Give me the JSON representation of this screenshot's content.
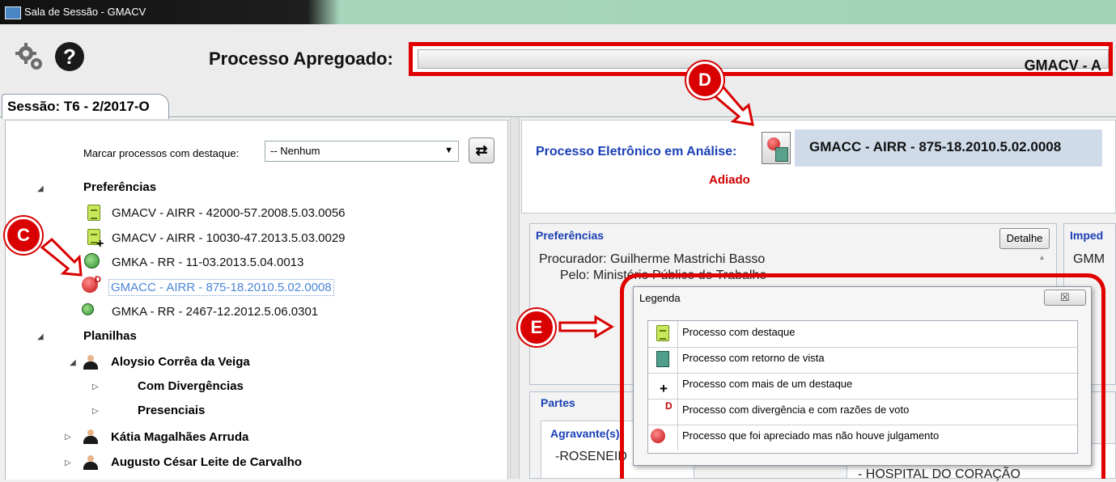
{
  "window": {
    "title": "Sala de Sessão - GMACV"
  },
  "toolbar": {
    "settings_icon": "gear-icon",
    "help_icon": "help-icon",
    "help_glyph": "?",
    "processo_label": "Processo Apregoado:",
    "processo_value": "GMACV - A"
  },
  "tab": {
    "label": "Sessão: T6 - 2/2017-O"
  },
  "left": {
    "marcar_label": "Marcar processos com destaque:",
    "marcar_value": "-- Nenhum",
    "tree": {
      "preferencias": {
        "label": "Preferências",
        "items": [
          {
            "label": "GMACV - AIRR - 42000-57.2008.5.03.0056",
            "icon": "destaque-doc-icon"
          },
          {
            "label": "GMACV - AIRR - 10030-47.2013.5.03.0029",
            "icon": "destaque-plus-doc-icon"
          },
          {
            "label": "GMKA - RR - 11-03.2013.5.04.0013",
            "icon": "retorno-vista-icon"
          },
          {
            "label": "GMACC - AIRR - 875-18.2010.5.02.0008",
            "icon": "apreciado-divergencia-icon",
            "selected": true
          },
          {
            "label": "GMKA - RR - 2467-12.2012.5.06.0301",
            "icon": "retorno-vista-icon"
          }
        ]
      },
      "planilhas": {
        "label": "Planilhas",
        "ministros": [
          {
            "name": "Aloysio Corrêa da Veiga",
            "children": [
              "Com Divergências",
              "Presenciais"
            ]
          },
          {
            "name": "Kátia Magalhães Arruda"
          },
          {
            "name": "Augusto César Leite de Carvalho"
          }
        ]
      }
    }
  },
  "right": {
    "pe_label": "Processo Eletrônico em Análise:",
    "pe_numero": "GMACC - AIRR - 875-18.2010.5.02.0008",
    "status": "Adiado",
    "preferencias": {
      "title": "Preferências",
      "detalhe_button": "Detalhe",
      "procurador": "Procurador: Guilherme Mastrichi Basso",
      "pelo": "Pelo: Ministério Público do Trabalho"
    },
    "impedimentos": {
      "title": "Imped",
      "value": "GMM"
    },
    "partes": {
      "title": "Partes",
      "agravante_title": "Agravante(s)",
      "agravante_value": "-ROSENEID",
      "agravado_value": "- HOSPITAL DO CORAÇÃO"
    }
  },
  "legend": {
    "title": "Legenda",
    "close_glyph": "☒",
    "rows": [
      {
        "icon": "destaque-doc-icon",
        "text": "Processo com destaque"
      },
      {
        "icon": "retorno-vista-icon",
        "text": "Processo com retorno de vista"
      },
      {
        "icon": "plus-icon",
        "text": "Processo com mais de um destaque"
      },
      {
        "icon": "divergencia-d-icon",
        "text": "Processo com divergência e com razões de voto"
      },
      {
        "icon": "red-dot-icon",
        "text": "Processo que foi apreciado mas não houve julgamento"
      }
    ]
  },
  "callouts": {
    "c": "C",
    "d": "D",
    "e": "E"
  },
  "colors": {
    "annotation_red": "#e00000",
    "link_blue": "#1a3fb5",
    "adiado_red": "#d00000"
  }
}
